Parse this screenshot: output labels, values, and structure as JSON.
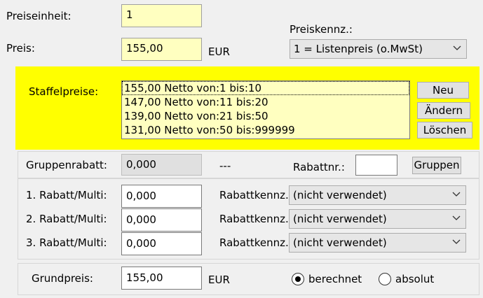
{
  "preiseinheit": {
    "label": "Preiseinheit:",
    "value": "1"
  },
  "preis": {
    "label": "Preis:",
    "value": "155,00",
    "currency": "EUR"
  },
  "preiskennz": {
    "label": "Preiskennz.:",
    "selected": "1 = Listenpreis (o.MwSt)"
  },
  "staffel": {
    "label": "Staffelpreise:",
    "items": [
      "155,00 Netto von:1 bis:10",
      "147,00 Netto von:11 bis:20",
      "139,00 Netto von:21 bis:50",
      "131,00 Netto von:50 bis:999999"
    ],
    "buttons": {
      "new": "Neu",
      "edit": "Ändern",
      "delete": "Löschen"
    }
  },
  "gruppe": {
    "label": "Gruppenrabatt:",
    "value": "0,000",
    "separator": "---",
    "rabattnr_label": "Rabattnr.:",
    "rabattnr_value": "",
    "button": "Gruppen"
  },
  "rabatte": [
    {
      "label": "1. Rabatt/Multi:",
      "value": "0,000",
      "kennz_label": "Rabattkennz.:",
      "kennz_value": "(nicht verwendet)"
    },
    {
      "label": "2. Rabatt/Multi:",
      "value": "0,000",
      "kennz_label": "Rabattkennz.:",
      "kennz_value": "(nicht verwendet)"
    },
    {
      "label": "3. Rabatt/Multi:",
      "value": "0,000",
      "kennz_label": "Rabattkennz.:",
      "kennz_value": "(nicht verwendet)"
    }
  ],
  "grundpreis": {
    "label": "Grundpreis:",
    "value": "155,00",
    "currency": "EUR",
    "options": [
      "berechnet",
      "absolut"
    ],
    "selected": "berechnet"
  },
  "colors": {
    "highlight": "#ffff00",
    "input_yellow": "#ffffc0"
  }
}
